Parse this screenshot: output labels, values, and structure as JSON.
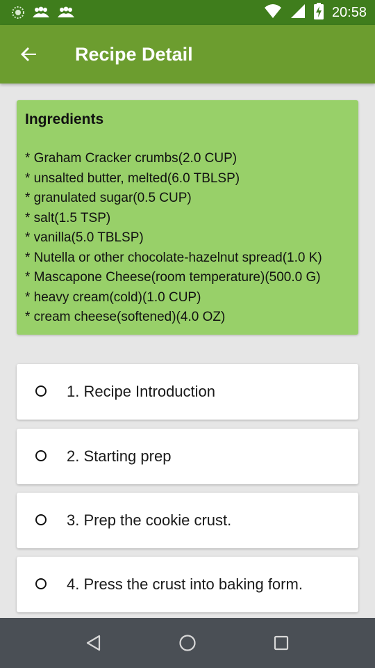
{
  "status_bar": {
    "time": "20:58",
    "icons": [
      "sync-icon",
      "people-icon",
      "people-icon",
      "wifi-icon",
      "signal-icon",
      "battery-charging-icon"
    ]
  },
  "app_bar": {
    "title": "Recipe Detail",
    "back_icon": "arrow-left-icon"
  },
  "ingredients": {
    "title": "Ingredients",
    "items": [
      "* Graham Cracker crumbs(2.0 CUP)",
      "* unsalted butter, melted(6.0 TBLSP)",
      "* granulated sugar(0.5 CUP)",
      "* salt(1.5 TSP)",
      "* vanilla(5.0 TBLSP)",
      "* Nutella or other chocolate-hazelnut spread(1.0 K)",
      "* Mascapone Cheese(room temperature)(500.0 G)",
      "* heavy cream(cold)(1.0 CUP)",
      "* cream cheese(softened)(4.0 OZ)"
    ]
  },
  "steps": [
    {
      "label": "1. Recipe Introduction"
    },
    {
      "label": "2. Starting prep"
    },
    {
      "label": "3. Prep the cookie crust."
    },
    {
      "label": "4. Press the crust into baking form."
    }
  ],
  "nav_bar": {
    "buttons": [
      "back-triangle-icon",
      "home-circle-icon",
      "recents-square-icon"
    ]
  },
  "colors": {
    "status_bar": "#3f7d1c",
    "app_bar": "#6c9d2f",
    "ingredients_card": "#98d069",
    "nav_bar": "#4a4f55",
    "background": "#e6e6e6"
  }
}
